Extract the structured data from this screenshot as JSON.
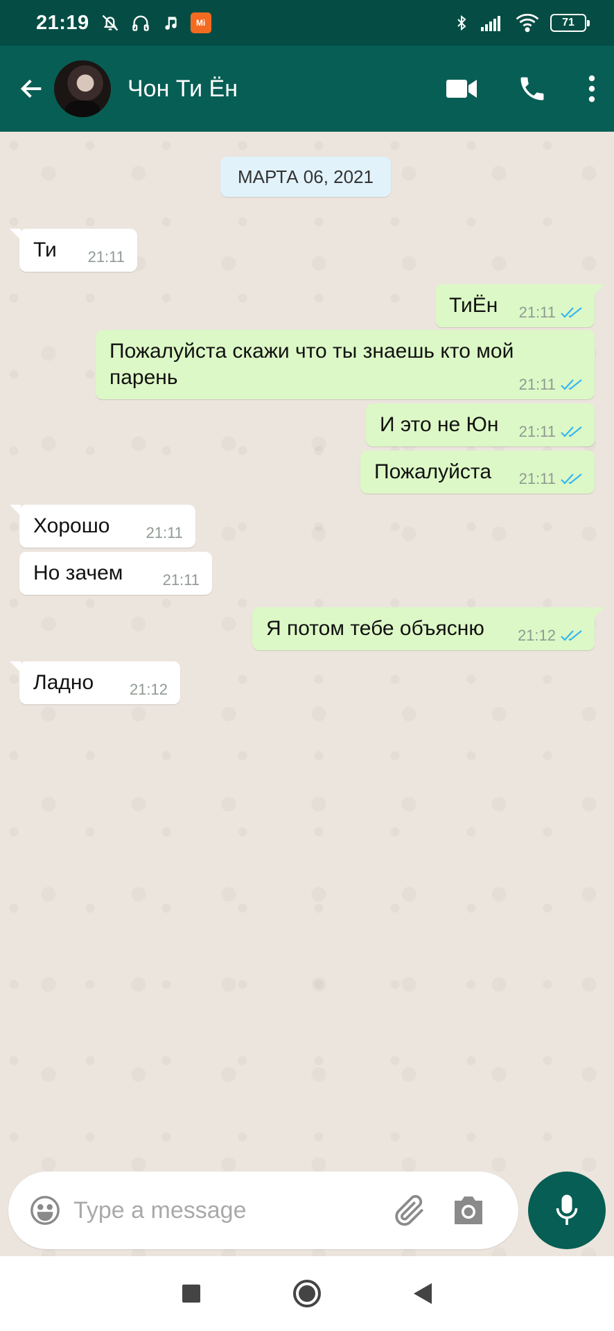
{
  "status_bar": {
    "time": "21:19",
    "mi_badge_text": "Mi",
    "battery": "71",
    "icons": [
      "mute-bell-icon",
      "headphones-icon",
      "music-note-icon",
      "mi-icon",
      "bluetooth-icon",
      "signal-icon",
      "wifi-icon",
      "battery-icon"
    ]
  },
  "header": {
    "contact_name": "Чон Ти Ён",
    "icons": [
      "back-arrow-icon",
      "video-call-icon",
      "phone-icon",
      "more-vert-icon"
    ]
  },
  "chat": {
    "date": "МАРТА 06, 2021",
    "messages": [
      {
        "dir": "in",
        "text": "Ти",
        "time": "21:11"
      },
      {
        "dir": "out",
        "text": "ТиЁн",
        "time": "21:11",
        "status": "read"
      },
      {
        "dir": "out",
        "text": "Пожалуйста скажи что ты знаешь кто мой парень",
        "time": "21:11",
        "status": "read"
      },
      {
        "dir": "out",
        "text": "И это не Юн",
        "time": "21:11",
        "status": "read"
      },
      {
        "dir": "out",
        "text": "Пожалуйста",
        "time": "21:11",
        "status": "read"
      },
      {
        "dir": "in",
        "text": "Хорошо",
        "time": "21:11"
      },
      {
        "dir": "in",
        "text": "Но зачем",
        "time": "21:11"
      },
      {
        "dir": "out",
        "text": "Я потом тебе объясню",
        "time": "21:12",
        "status": "read"
      },
      {
        "dir": "in",
        "text": "Ладно",
        "time": "21:12"
      }
    ]
  },
  "input": {
    "placeholder": "Type a message",
    "value": ""
  },
  "colors": {
    "header": "#075e54",
    "status_bar": "#054d44",
    "outgoing_bubble": "#dcf8c6",
    "incoming_bubble": "#ffffff",
    "read_ticks": "#34b7f1",
    "chat_bg": "#ece5dd"
  }
}
